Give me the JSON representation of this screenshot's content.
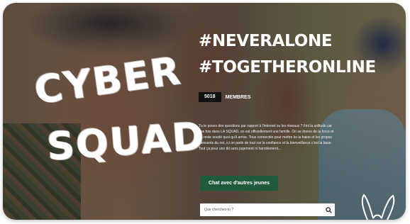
{
  "hero": {
    "logo_line1": "CYBER",
    "logo_line2": "SQUAD",
    "hashtag1": "#NEVERALONE",
    "hashtag2": "#TOGETHERONLINE",
    "member_count": "5018",
    "member_label": "MEMBRES",
    "description": "Tu te poses des questions par rapport à l'internet ou les réseaux ? Fini la solitude car une fois dans LA SQUAD, on est officiellement une famille. On se donne de la force et on reste soudé quoi qu'il arrive. Tous connectés pour mettre ko la haine et les propos blessants du net, ici on parle de tout car la confiance et la bienveillance c'est la base. Tout ça pour une tkt sans jugement ni harcèlement...",
    "cta_label": "Chat avec d'autres jeunes",
    "search_placeholder": "Que cherches-tu ?"
  },
  "icons": {
    "search": "search-icon",
    "mascot": "bunny-icon"
  },
  "colors": {
    "cta": "#1f5a3a",
    "text": "#ffffff",
    "badge": "#111111"
  }
}
